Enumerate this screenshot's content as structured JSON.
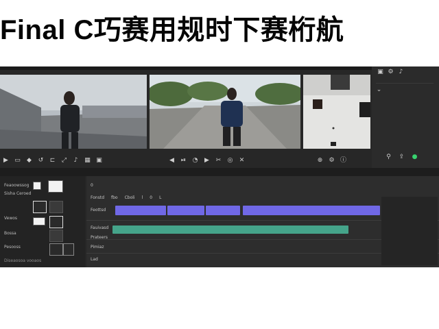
{
  "headline": "Final C巧赛用规时下赛桁航",
  "colors": {
    "purple_clip": "#7068e6",
    "green_clip": "#45a48a",
    "app_bg": "#272727"
  },
  "timeline": {
    "header_items": [
      "Fonstd",
      "fbo",
      "Cboli",
      "l",
      "0",
      "0",
      "L"
    ],
    "track_labels": [
      "Feottsd",
      "Fauivasd",
      "Prateers",
      "Pimiaz"
    ],
    "bottom_label": "Lad"
  },
  "browser": {
    "items": [
      "Feaoowssog",
      "Sisha Ceroed",
      "Vewos",
      "Bossa",
      "Pesooss"
    ],
    "footer": "Diseaosoa vooaos"
  },
  "inspector": {
    "title_icons": [
      "inspector-icon",
      "settings-icon"
    ]
  }
}
